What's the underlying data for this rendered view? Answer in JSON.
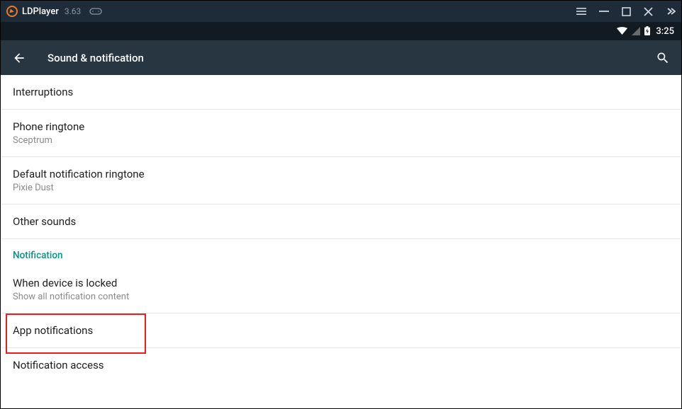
{
  "titlebar": {
    "app_name": "LDPlayer",
    "app_version": "3.63"
  },
  "statusbar": {
    "time": "3:25"
  },
  "appbar": {
    "title": "Sound & notification"
  },
  "settings": {
    "interruptions": {
      "title": "Interruptions"
    },
    "phone_ringtone": {
      "title": "Phone ringtone",
      "value": "Sceptrum"
    },
    "default_notification_ringtone": {
      "title": "Default notification ringtone",
      "value": "Pixie Dust"
    },
    "other_sounds": {
      "title": "Other sounds"
    },
    "section_notification": "Notification",
    "when_device_locked": {
      "title": "When device is locked",
      "value": "Show all notification content"
    },
    "app_notifications": {
      "title": "App notifications"
    },
    "notification_access": {
      "title": "Notification access"
    }
  }
}
